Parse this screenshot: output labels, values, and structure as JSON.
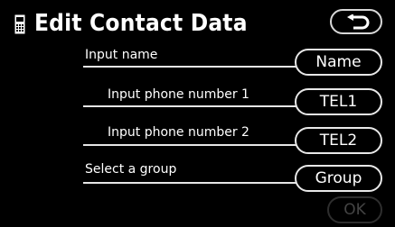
{
  "header": {
    "title": "Edit Contact Data",
    "phone_icon": "phone-book-icon",
    "back_icon": "return-arrow-icon"
  },
  "rows": [
    {
      "label": "Input name",
      "button": "Name"
    },
    {
      "label": "Input phone number 1",
      "button": "TEL1"
    },
    {
      "label": "Input phone number 2",
      "button": "TEL2"
    },
    {
      "label": "Select a group",
      "button": "Group"
    }
  ],
  "ok_button": {
    "label": "OK",
    "enabled": false
  },
  "colors": {
    "background": "#000000",
    "text": "#ffffff",
    "outline": "#e8e8e8",
    "disabled": "#444444"
  }
}
